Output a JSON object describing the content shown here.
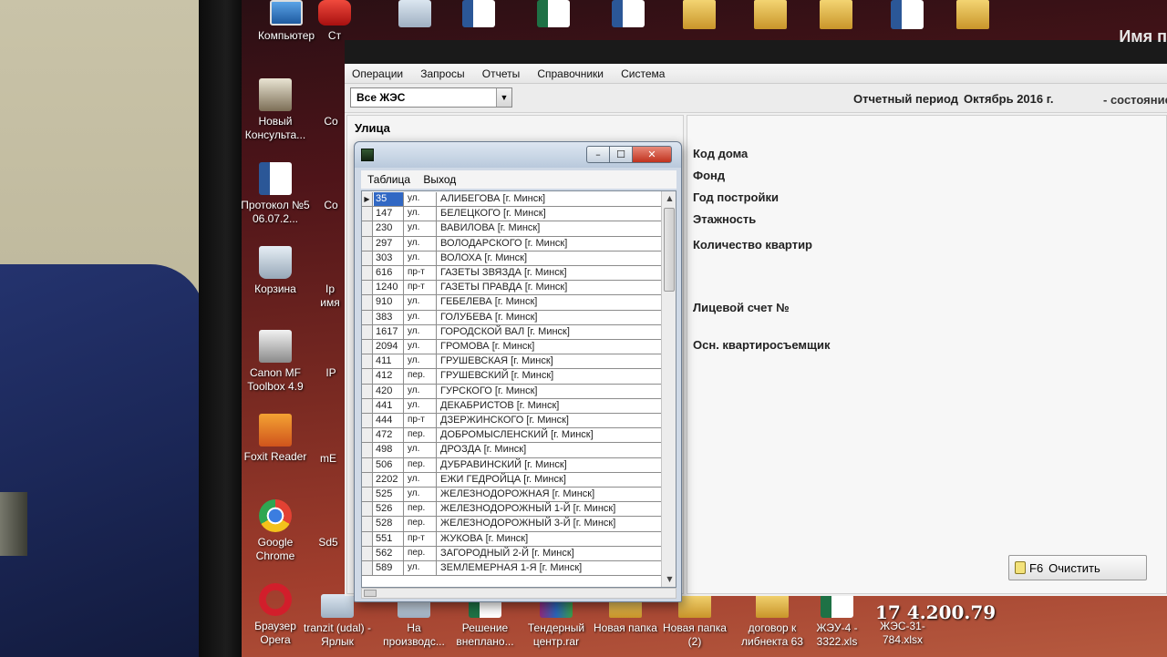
{
  "desktop": {
    "left_column": [
      {
        "label": "Компьютер",
        "icon": "computer-icon"
      },
      {
        "label": "Новый Консульта...",
        "icon": "consultant-icon"
      },
      {
        "label": "Протокол №5 06.07.2...",
        "icon": "word-doc-icon"
      },
      {
        "label": "Корзина",
        "icon": "recycle-bin-icon"
      },
      {
        "label": "Canon MF Toolbox 4.9",
        "icon": "canon-icon"
      },
      {
        "label": "Foxit Reader",
        "icon": "foxit-icon"
      },
      {
        "label": "Google Chrome",
        "icon": "chrome-icon"
      },
      {
        "label": "Браузер Opera",
        "icon": "opera-icon"
      }
    ],
    "second_column_partial": [
      "Ст",
      "Со",
      "Ip имя",
      "IP",
      "mE",
      "Sd5"
    ],
    "bottom_row": [
      {
        "label": "tranzit (udal) - Ярлык",
        "icon": "shortcut-icon"
      },
      {
        "label": "На производс...",
        "icon": "document-icon"
      },
      {
        "label": "Решение внеплано...",
        "icon": "excel-icon"
      },
      {
        "label": "Тендерный центр.rar",
        "icon": "rar-icon"
      },
      {
        "label": "Новая папка",
        "icon": "folder-icon"
      },
      {
        "label": "Новая папка (2)",
        "icon": "folder-icon"
      },
      {
        "label": "договор к либнекта 63",
        "icon": "folder-icon"
      },
      {
        "label": "ЖЭУ-4 - 3322.xls",
        "icon": "excel-icon"
      },
      {
        "label": "ЖЭС-31- 784.xlsx",
        "icon": "excel-icon"
      }
    ],
    "ip_text": "17  4.200.79"
  },
  "app": {
    "user_label": "Имя п",
    "menu": [
      "Операции",
      "Запросы",
      "Отчеты",
      "Справочники",
      "Система"
    ],
    "zes_select": "Все ЖЭС",
    "period_label": "Отчетный период",
    "period_value": "Октябрь 2016 г.",
    "state_label": "- состояние",
    "street_header": "Улица",
    "fields": {
      "house_code": "Код дома",
      "fund": "Фонд",
      "year_built": "Год постройки",
      "floors": "Этажность",
      "apartments": "Количество квартир",
      "account": "Лицевой счет №",
      "tenant": "Осн. квартиросъемщик"
    },
    "clear_button": {
      "key": "F6",
      "label": "Очистить"
    }
  },
  "popup": {
    "menu": [
      "Таблица",
      "Выход"
    ],
    "rows": [
      {
        "code": "35",
        "type": "ул.",
        "name": "АЛИБЕГОВА [г. Минск]"
      },
      {
        "code": "147",
        "type": "ул.",
        "name": "БЕЛЕЦКОГО [г. Минск]"
      },
      {
        "code": "230",
        "type": "ул.",
        "name": "ВАВИЛОВА [г. Минск]"
      },
      {
        "code": "297",
        "type": "ул.",
        "name": "ВОЛОДАРСКОГО [г. Минск]"
      },
      {
        "code": "303",
        "type": "ул.",
        "name": "ВОЛОХА [г. Минск]"
      },
      {
        "code": "616",
        "type": "пр-т",
        "name": "ГАЗЕТЫ ЗВЯЗДА [г. Минск]"
      },
      {
        "code": "1240",
        "type": "пр-т",
        "name": "ГАЗЕТЫ ПРАВДА [г. Минск]"
      },
      {
        "code": "910",
        "type": "ул.",
        "name": "ГЕБЕЛЕВА [г. Минск]"
      },
      {
        "code": "383",
        "type": "ул.",
        "name": "ГОЛУБЕВА [г. Минск]"
      },
      {
        "code": "1617",
        "type": "ул.",
        "name": "ГОРОДСКОЙ ВАЛ [г. Минск]"
      },
      {
        "code": "2094",
        "type": "ул.",
        "name": "ГРОМОВА [г. Минск]"
      },
      {
        "code": "411",
        "type": "ул.",
        "name": "ГРУШЕВСКАЯ [г. Минск]"
      },
      {
        "code": "412",
        "type": "пер.",
        "name": "ГРУШЕВСКИЙ [г. Минск]"
      },
      {
        "code": "420",
        "type": "ул.",
        "name": "ГУРСКОГО [г. Минск]"
      },
      {
        "code": "441",
        "type": "ул.",
        "name": "ДЕКАБРИСТОВ [г. Минск]"
      },
      {
        "code": "444",
        "type": "пр-т",
        "name": "ДЗЕРЖИНСКОГО [г. Минск]"
      },
      {
        "code": "472",
        "type": "пер.",
        "name": "ДОБРОМЫСЛЕНСКИЙ [г. Минск]"
      },
      {
        "code": "498",
        "type": "ул.",
        "name": "ДРОЗДА [г. Минск]"
      },
      {
        "code": "506",
        "type": "пер.",
        "name": "ДУБРАВИНСКИЙ [г. Минск]"
      },
      {
        "code": "2202",
        "type": "ул.",
        "name": "ЕЖИ ГЕДРОЙЦА [г. Минск]"
      },
      {
        "code": "525",
        "type": "ул.",
        "name": "ЖЕЛЕЗНОДОРОЖНАЯ [г. Минск]"
      },
      {
        "code": "526",
        "type": "пер.",
        "name": "ЖЕЛЕЗНОДОРОЖНЫЙ 1-Й [г. Минск]"
      },
      {
        "code": "528",
        "type": "пер.",
        "name": "ЖЕЛЕЗНОДОРОЖНЫЙ 3-Й [г. Минск]"
      },
      {
        "code": "551",
        "type": "пр-т",
        "name": "ЖУКОВА [г. Минск]"
      },
      {
        "code": "562",
        "type": "пер.",
        "name": "ЗАГОРОДНЫЙ 2-Й [г. Минск]"
      },
      {
        "code": "589",
        "type": "ул.",
        "name": "ЗЕМЛЕМЕРНАЯ 1-Я [г. Минск]"
      }
    ],
    "selected_index": 0,
    "colors": {
      "selection": "#3168c4",
      "close_button": "#c0321e"
    }
  }
}
